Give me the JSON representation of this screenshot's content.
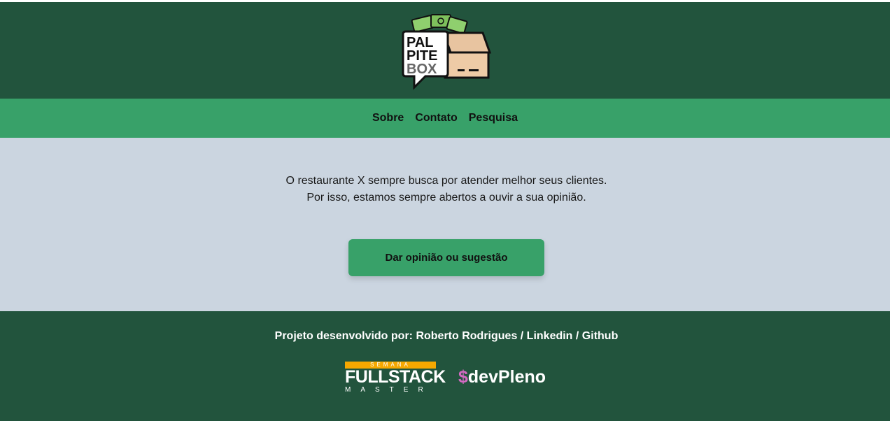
{
  "header": {
    "logo": {
      "line1": "PAL",
      "line2": "PITE",
      "line3": "BOX"
    }
  },
  "nav": {
    "items": [
      "Sobre",
      "Contato",
      "Pesquisa"
    ]
  },
  "main": {
    "intro_line1": "O restaurante X sempre busca por atender melhor seus clientes.",
    "intro_line2": "Por isso, estamos sempre abertos a ouvir a sua opinião.",
    "cta_label": "Dar opinião ou sugestão"
  },
  "footer": {
    "credits_prefix": "Projeto desenvolvido por: Roberto Rodrigues / ",
    "linkedin": "Linkedin",
    "separator": " / ",
    "github": "Github",
    "fullstack": {
      "top": "SEMANA",
      "main": "FULLSTACK",
      "sub": "MASTER"
    },
    "devpleno": {
      "dollar": "$",
      "name": "devPleno"
    }
  },
  "colors": {
    "dark_green": "#22543d",
    "green": "#38a169",
    "gray_bg": "#cbd5e0",
    "orange": "#f6a800",
    "pink": "#d36ac2"
  }
}
